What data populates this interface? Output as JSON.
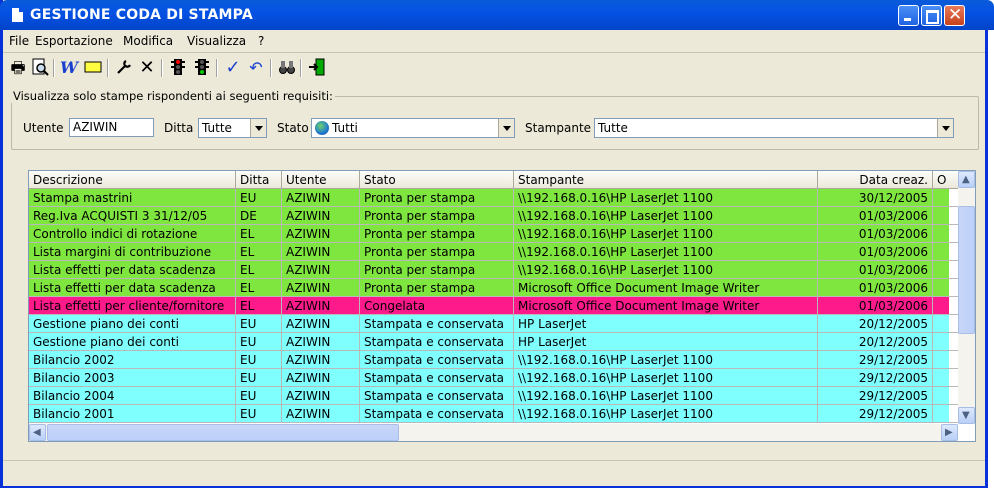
{
  "window": {
    "title": "GESTIONE CODA DI STAMPA"
  },
  "menu": [
    "File",
    "Esportazione",
    "Modifica",
    "Visualizza",
    "?"
  ],
  "toolbar": {
    "icons": [
      "printer-icon",
      "print-preview-icon",
      "word-icon",
      "rectangle-icon",
      "wrench-icon",
      "delete-icon",
      "traffic-light-red-icon",
      "traffic-light-green-icon",
      "check-icon",
      "undo-icon",
      "binoculars-icon",
      "exit-icon"
    ]
  },
  "filter": {
    "legend": "Visualizza solo stampe rispondenti ai seguenti requisiti:",
    "utente_label": "Utente",
    "utente_value": "AZIWIN",
    "ditta_label": "Ditta",
    "ditta_value": "Tutte",
    "stato_label": "Stato",
    "stato_value": "Tutti",
    "stampante_label": "Stampante",
    "stampante_value": "Tutte"
  },
  "grid": {
    "columns": [
      "Descrizione",
      "Ditta",
      "Utente",
      "Stato",
      "Stampante",
      "Data creaz.",
      "O"
    ],
    "colors": {
      "ready": "#7fe640",
      "frozen": "#ff1a8c",
      "printed": "#80ffff"
    },
    "rows": [
      {
        "status": "ready",
        "descrizione": "Stampa mastrini",
        "ditta": "EU",
        "utente": "AZIWIN",
        "stato": "Pronta per stampa",
        "stampante": "\\\\192.168.0.16\\HP LaserJet 1100",
        "data": "30/12/2005"
      },
      {
        "status": "ready",
        "descrizione": "Reg.Iva ACQUISTI 3 31/12/05",
        "ditta": "DE",
        "utente": "AZIWIN",
        "stato": "Pronta per stampa",
        "stampante": "\\\\192.168.0.16\\HP LaserJet 1100",
        "data": "01/03/2006"
      },
      {
        "status": "ready",
        "descrizione": "Controllo indici di rotazione",
        "ditta": "EL",
        "utente": "AZIWIN",
        "stato": "Pronta per stampa",
        "stampante": "\\\\192.168.0.16\\HP LaserJet 1100",
        "data": "01/03/2006"
      },
      {
        "status": "ready",
        "descrizione": "Lista margini di contribuzione",
        "ditta": "EL",
        "utente": "AZIWIN",
        "stato": "Pronta per stampa",
        "stampante": "\\\\192.168.0.16\\HP LaserJet 1100",
        "data": "01/03/2006"
      },
      {
        "status": "ready",
        "descrizione": "Lista effetti per data scadenza",
        "ditta": "EL",
        "utente": "AZIWIN",
        "stato": "Pronta per stampa",
        "stampante": "\\\\192.168.0.16\\HP LaserJet 1100",
        "data": "01/03/2006"
      },
      {
        "status": "ready",
        "descrizione": "Lista effetti per data scadenza",
        "ditta": "EL",
        "utente": "AZIWIN",
        "stato": "Pronta per stampa",
        "stampante": "Microsoft Office Document Image Writer",
        "data": "01/03/2006"
      },
      {
        "status": "frozen",
        "descrizione": "Lista effetti per cliente/fornitore",
        "ditta": "EL",
        "utente": "AZIWIN",
        "stato": "Congelata",
        "stampante": "Microsoft Office Document Image Writer",
        "data": "01/03/2006"
      },
      {
        "status": "printed",
        "descrizione": "Gestione piano dei conti",
        "ditta": "EU",
        "utente": "AZIWIN",
        "stato": "Stampata e conservata",
        "stampante": "HP LaserJet",
        "data": "20/12/2005"
      },
      {
        "status": "printed",
        "descrizione": "Gestione piano dei conti",
        "ditta": "EU",
        "utente": "AZIWIN",
        "stato": "Stampata e conservata",
        "stampante": "HP LaserJet",
        "data": "20/12/2005"
      },
      {
        "status": "printed",
        "descrizione": "Bilancio 2002",
        "ditta": "EU",
        "utente": "AZIWIN",
        "stato": "Stampata e conservata",
        "stampante": "\\\\192.168.0.16\\HP LaserJet 1100",
        "data": "29/12/2005"
      },
      {
        "status": "printed",
        "descrizione": "Bilancio 2003",
        "ditta": "EU",
        "utente": "AZIWIN",
        "stato": "Stampata e conservata",
        "stampante": "\\\\192.168.0.16\\HP LaserJet 1100",
        "data": "29/12/2005"
      },
      {
        "status": "printed",
        "descrizione": "Bilancio 2004",
        "ditta": "EU",
        "utente": "AZIWIN",
        "stato": "Stampata e conservata",
        "stampante": "\\\\192.168.0.16\\HP LaserJet 1100",
        "data": "29/12/2005"
      },
      {
        "status": "printed",
        "descrizione": "Bilancio 2001",
        "ditta": "EU",
        "utente": "AZIWIN",
        "stato": "Stampata e conservata",
        "stampante": "\\\\192.168.0.16\\HP LaserJet 1100",
        "data": "29/12/2005"
      }
    ]
  }
}
